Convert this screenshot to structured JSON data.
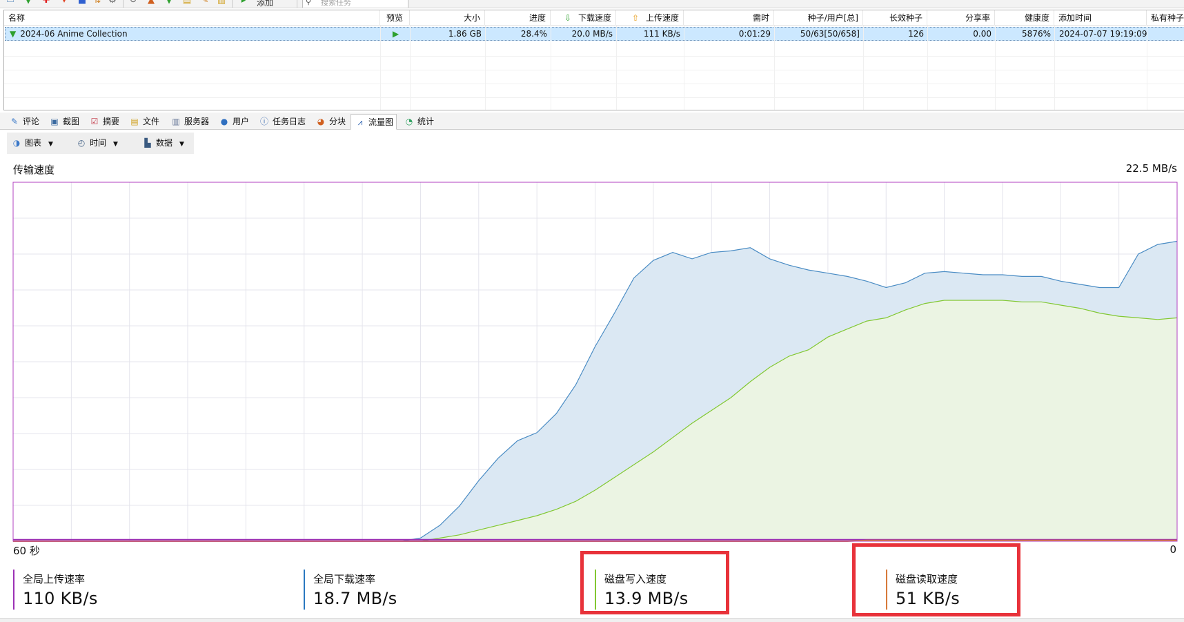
{
  "toolbar": {
    "add_label": "添加",
    "search_placeholder": "搜索任务"
  },
  "columns": [
    "名称",
    "预览",
    "大小",
    "进度",
    "下载速度",
    "上传速度",
    "需时",
    "种子/用户[总]",
    "长效种子",
    "分享率",
    "健康度",
    "添加时间",
    "私有种子"
  ],
  "torrent": {
    "name": "2024-06 Anime Collection",
    "preview_icon": "play-icon",
    "size": "1.86 GB",
    "progress": "28.4%",
    "download_speed": "20.0 MB/s",
    "upload_speed": "111 KB/s",
    "eta": "0:01:29",
    "seeds_peers": "50/63[50/658]",
    "long_term_seeds": "126",
    "share_ratio": "0.00",
    "health": "5876%",
    "added_time": "2024-07-07 19:19:09"
  },
  "tabs": [
    {
      "label": "评论",
      "icon": "comment-icon"
    },
    {
      "label": "截图",
      "icon": "screenshot-icon"
    },
    {
      "label": "摘要",
      "icon": "summary-icon"
    },
    {
      "label": "文件",
      "icon": "files-icon"
    },
    {
      "label": "服务器",
      "icon": "server-icon"
    },
    {
      "label": "用户",
      "icon": "users-icon"
    },
    {
      "label": "任务日志",
      "icon": "log-icon"
    },
    {
      "label": "分块",
      "icon": "pieces-icon"
    },
    {
      "label": "流量图",
      "icon": "traffic-graph-icon",
      "active": true
    },
    {
      "label": "统计",
      "icon": "stats-icon"
    }
  ],
  "graph_toolbar": {
    "chart_label": "图表",
    "time_label": "时间",
    "data_label": "数据"
  },
  "chart_data": {
    "type": "area",
    "title": "传输速度",
    "y_max_label": "22.5 MB/s",
    "x_left_label": "60 秒",
    "x_right_label": "0",
    "ylim": [
      0,
      22.5
    ],
    "xlim": [
      0,
      60
    ],
    "grid": true,
    "x": [
      0,
      1,
      2,
      3,
      4,
      5,
      6,
      7,
      8,
      9,
      10,
      11,
      12,
      13,
      14,
      15,
      16,
      17,
      18,
      19,
      20,
      21,
      22,
      23,
      24,
      25,
      26,
      27,
      28,
      29,
      30,
      31,
      32,
      33,
      34,
      35,
      36,
      37,
      38,
      39,
      40,
      41,
      42,
      43,
      44,
      45,
      46,
      47,
      48,
      49,
      50,
      51,
      52,
      53,
      54,
      55,
      56,
      57,
      58,
      59,
      60
    ],
    "series": [
      {
        "name": "全局下载速率",
        "color": "#4a8cc4",
        "fill": "#dbe8f3",
        "values": [
          0,
          0,
          0,
          0,
          0,
          0,
          0,
          0,
          0,
          0,
          0,
          0,
          0,
          0,
          0,
          0,
          0,
          0,
          0,
          0,
          0,
          0.2,
          1.0,
          2.2,
          3.8,
          5.2,
          6.3,
          6.8,
          8.0,
          9.8,
          12.2,
          14.3,
          16.5,
          17.6,
          18.1,
          17.7,
          18.1,
          18.2,
          18.4,
          17.7,
          17.3,
          17.0,
          16.8,
          16.6,
          16.3,
          15.9,
          16.2,
          16.8,
          16.9,
          16.8,
          16.7,
          16.7,
          16.6,
          16.6,
          16.3,
          16.1,
          15.9,
          15.9,
          18.0,
          18.6,
          18.8
        ]
      },
      {
        "name": "磁盘写入速度",
        "color": "#82c832",
        "fill": "#ebf4e3",
        "values": [
          0,
          0,
          0,
          0,
          0,
          0,
          0,
          0,
          0,
          0,
          0,
          0,
          0,
          0,
          0,
          0,
          0,
          0,
          0,
          0,
          0,
          0,
          0.2,
          0.4,
          0.7,
          1.0,
          1.3,
          1.6,
          2.0,
          2.5,
          3.2,
          4.0,
          4.8,
          5.6,
          6.5,
          7.4,
          8.2,
          9.0,
          10.0,
          10.9,
          11.6,
          12.0,
          12.8,
          13.3,
          13.8,
          14.0,
          14.5,
          14.9,
          15.1,
          15.1,
          15.1,
          15.1,
          15.0,
          15.0,
          14.8,
          14.6,
          14.3,
          14.1,
          14.0,
          13.9,
          14.0
        ]
      },
      {
        "name": "全局上传速率",
        "color": "#9b30b5",
        "values": [
          0.1,
          0.1,
          0.1,
          0.1,
          0.1,
          0.1,
          0.1,
          0.1,
          0.1,
          0.1,
          0.1,
          0.1,
          0.1,
          0.1,
          0.1,
          0.1,
          0.1,
          0.1,
          0.1,
          0.1,
          0.1,
          0.1,
          0.1,
          0.1,
          0.1,
          0.1,
          0.1,
          0.1,
          0.1,
          0.1,
          0.1,
          0.1,
          0.1,
          0.1,
          0.1,
          0.1,
          0.1,
          0.1,
          0.1,
          0.1,
          0.1,
          0.1,
          0.1,
          0.1,
          0.1,
          0.1,
          0.1,
          0.1,
          0.1,
          0.1,
          0.1,
          0.1,
          0.1,
          0.1,
          0.1,
          0.1,
          0.1,
          0.1,
          0.1,
          0.1,
          0.1
        ]
      },
      {
        "name": "磁盘读取速度",
        "color": "#d77a3a",
        "values": [
          0,
          0,
          0,
          0,
          0,
          0,
          0,
          0,
          0,
          0,
          0,
          0,
          0,
          0,
          0,
          0,
          0,
          0,
          0,
          0,
          0,
          0,
          0,
          0,
          0,
          0,
          0,
          0,
          0,
          0,
          0,
          0,
          0,
          0,
          0,
          0,
          0,
          0,
          0,
          0,
          0,
          0,
          0,
          0,
          0.05,
          0.05,
          0.05,
          0.05,
          0.05,
          0.05,
          0.05,
          0.05,
          0.05,
          0.05,
          0.05,
          0.05,
          0.05,
          0.05,
          0.05,
          0.05,
          0.05
        ]
      }
    ]
  },
  "stats": [
    {
      "label": "全局上传速率",
      "value": "110 KB/s",
      "color": "#9b30b5"
    },
    {
      "label": "全局下载速率",
      "value": "18.7 MB/s",
      "color": "#2a78c0"
    },
    {
      "label": "磁盘写入速度",
      "value": "13.9 MB/s",
      "color": "#82c832"
    },
    {
      "label": "磁盘读取速度",
      "value": "51 KB/s",
      "color": "#d77a3a"
    }
  ],
  "colors": {
    "highlight": "#e8323a",
    "selection": "#cce8ff",
    "chart_border": "#b040c0",
    "grid": "#e4e4ec"
  }
}
